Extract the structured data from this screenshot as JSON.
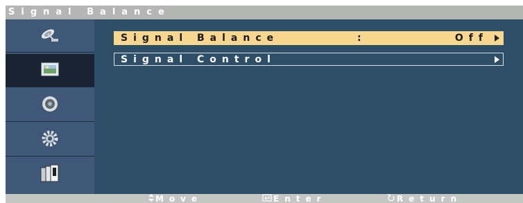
{
  "title": "Signal Balance",
  "sidebar": {
    "items": [
      {
        "icon": "satellite-dish-icon",
        "active": false
      },
      {
        "icon": "picture-icon",
        "active": true
      },
      {
        "icon": "speaker-icon",
        "active": false
      },
      {
        "icon": "gear-icon",
        "active": false
      },
      {
        "icon": "multi-screen-icon",
        "active": false
      }
    ]
  },
  "menu": {
    "items": [
      {
        "label": "Signal Balance",
        "separator": ":",
        "value": "Off",
        "selected": true
      },
      {
        "label": "Signal Control",
        "selected": false
      }
    ]
  },
  "footer": {
    "move": "Move",
    "enter": "Enter",
    "return": "Return"
  },
  "colors": {
    "title_bar": "#b4b6b4",
    "sidebar": "#3f5878",
    "sidebar_active": "#1a2433",
    "main": "#2e4e68",
    "highlight": "#f7d78f",
    "footer": "#c3c6c2"
  }
}
